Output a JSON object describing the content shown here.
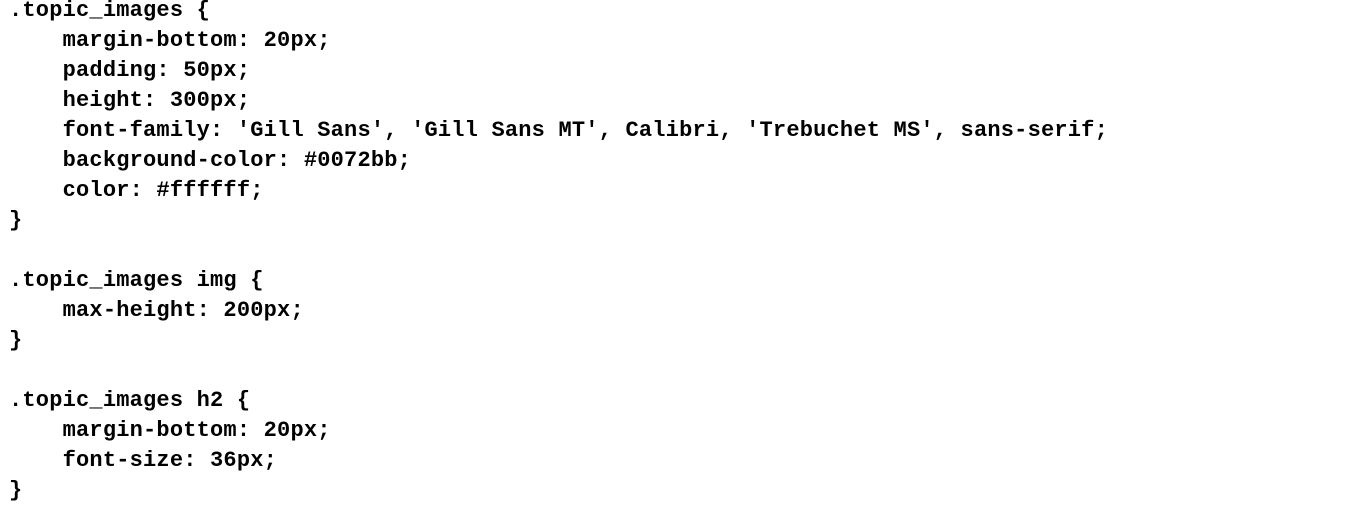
{
  "code": {
    "lines": [
      ".topic_images {",
      "    margin-bottom: 20px;",
      "    padding: 50px;",
      "    height: 300px;",
      "    font-family: 'Gill Sans', 'Gill Sans MT', Calibri, 'Trebuchet MS', sans-serif;",
      "    background-color: #0072bb;",
      "    color: #ffffff;",
      "}",
      "",
      ".topic_images img {",
      "    max-height: 200px;",
      "}",
      "",
      ".topic_images h2 {",
      "    margin-bottom: 20px;",
      "    font-size: 36px;",
      "}"
    ]
  }
}
